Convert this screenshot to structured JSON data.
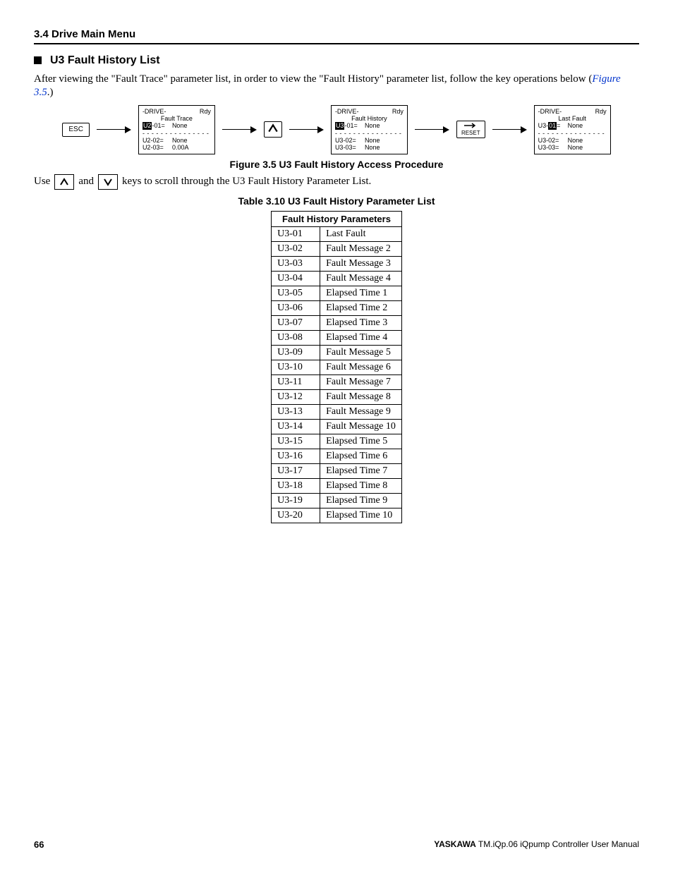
{
  "header": {
    "section": "3.4  Drive Main Menu"
  },
  "subheading": "U3 Fault History List",
  "intro": {
    "text_before_link": "After viewing the \"Fault Trace\" parameter list, in order to view the \"Fault History\" parameter list, follow the key operations below (",
    "link": "Figure 3.5",
    "text_after_link": ".)"
  },
  "procedure": {
    "esc_label": "ESC",
    "reset_label": "RESET",
    "screens": [
      {
        "drive": "-DRIVE-",
        "rdy": "Rdy",
        "title": "Fault Trace",
        "row1": {
          "pre": "U2",
          "hl": "-01",
          "eq": "=",
          "val": "None"
        },
        "row2": {
          "pre": "U2-02=",
          "val": "None"
        },
        "row3": {
          "pre": "U2-03=",
          "val": "0.00A"
        },
        "hl_mode": "pre"
      },
      {
        "drive": "-DRIVE-",
        "rdy": "Rdy",
        "title": "Fault History",
        "row1": {
          "pre": "U3",
          "hl": "-01",
          "eq": "=",
          "val": "None"
        },
        "row2": {
          "pre": "U3-02=",
          "val": "None"
        },
        "row3": {
          "pre": "U3-03=",
          "val": "None"
        },
        "hl_mode": "pre"
      },
      {
        "drive": "-DRIVE-",
        "rdy": "Rdy",
        "title": "Last Fault",
        "row1": {
          "pre": "U3-",
          "hl": "01",
          "eq": "=",
          "val": "None"
        },
        "row2": {
          "pre": "U3-02=",
          "val": "None"
        },
        "row3": {
          "pre": "U3-03=",
          "val": "None"
        },
        "hl_mode": "mid"
      }
    ]
  },
  "figure_caption": "Figure 3.5  U3 Fault History Access Procedure",
  "scroll_line": {
    "prefix": "Use",
    "mid": "and",
    "suffix": "keys to scroll through the U3 Fault History Parameter List."
  },
  "table_caption": "Table 3.10  U3 Fault History Parameter List",
  "table": {
    "header": "Fault History Parameters",
    "rows": [
      {
        "code": "U3-01",
        "desc": "Last Fault"
      },
      {
        "code": "U3-02",
        "desc": "Fault Message 2"
      },
      {
        "code": "U3-03",
        "desc": "Fault Message 3"
      },
      {
        "code": "U3-04",
        "desc": "Fault Message 4"
      },
      {
        "code": "U3-05",
        "desc": "Elapsed Time 1"
      },
      {
        "code": "U3-06",
        "desc": "Elapsed Time 2"
      },
      {
        "code": "U3-07",
        "desc": "Elapsed Time 3"
      },
      {
        "code": "U3-08",
        "desc": "Elapsed Time 4"
      },
      {
        "code": "U3-09",
        "desc": "Fault Message 5"
      },
      {
        "code": "U3-10",
        "desc": "Fault Message 6"
      },
      {
        "code": "U3-11",
        "desc": "Fault Message 7"
      },
      {
        "code": "U3-12",
        "desc": "Fault Message 8"
      },
      {
        "code": "U3-13",
        "desc": "Fault Message 9"
      },
      {
        "code": "U3-14",
        "desc": "Fault Message 10"
      },
      {
        "code": "U3-15",
        "desc": "Elapsed Time 5"
      },
      {
        "code": "U3-16",
        "desc": "Elapsed Time 6"
      },
      {
        "code": "U3-17",
        "desc": "Elapsed Time 7"
      },
      {
        "code": "U3-18",
        "desc": "Elapsed Time 8"
      },
      {
        "code": "U3-19",
        "desc": "Elapsed Time 9"
      },
      {
        "code": "U3-20",
        "desc": "Elapsed Time 10"
      }
    ]
  },
  "footer": {
    "page": "66",
    "brand": "YASKAWA",
    "manual": " TM.iQp.06 iQpump Controller User Manual"
  }
}
